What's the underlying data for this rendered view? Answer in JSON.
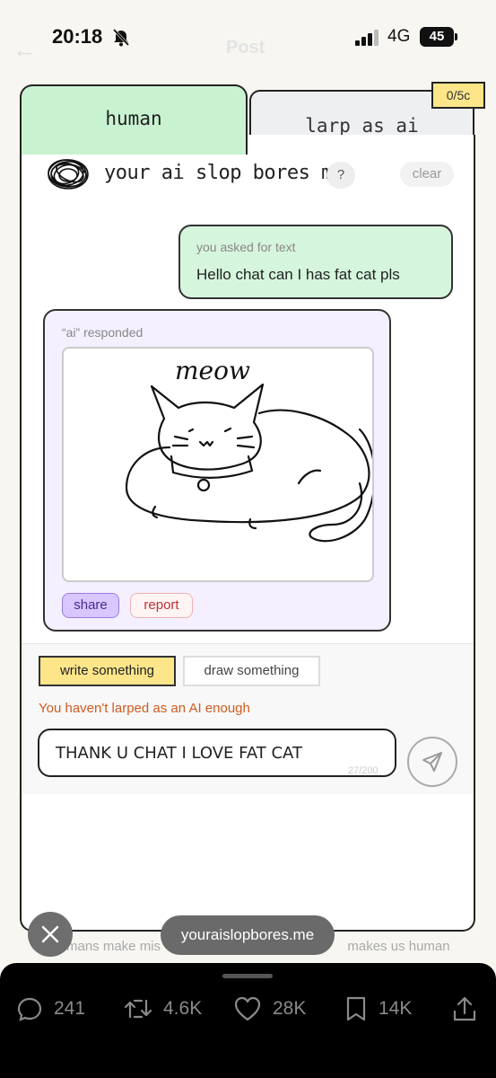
{
  "status": {
    "time": "20:18",
    "network": "4G",
    "battery": "45"
  },
  "header": {
    "back_ghost": "←",
    "title_ghost": "Post"
  },
  "tabs": {
    "human": "human",
    "ai": "larp as ai"
  },
  "credit_badge": "0/5c",
  "app": {
    "title": "your ai slop bores me",
    "help_label": "?",
    "clear_label": "clear"
  },
  "user_message": {
    "meta": "you asked for text",
    "text": "Hello chat can I has fat cat pls"
  },
  "ai_message": {
    "meta": "“ai” responded",
    "drawing_text": "meow",
    "share_label": "share",
    "report_label": "report"
  },
  "composer": {
    "write_label": "write something",
    "draw_label": "draw something",
    "warning": "You haven't larped as an AI enough",
    "input_value": "THANK U CHAT I LOVE FAT CAT",
    "counter": "27/200"
  },
  "footer": {
    "hint_left": "mans make mis",
    "hint_right": "makes us human",
    "url": "youraislopbores.me"
  },
  "actions": {
    "replies": "241",
    "reposts": "4.6K",
    "likes": "28K",
    "bookmarks": "14K"
  },
  "colors": {
    "human_tab": "#c9f2d1",
    "user_bubble": "#d6f5dd",
    "ai_bubble": "#f4f0ff",
    "credit": "#fde58a",
    "warning": "#d05a20"
  }
}
